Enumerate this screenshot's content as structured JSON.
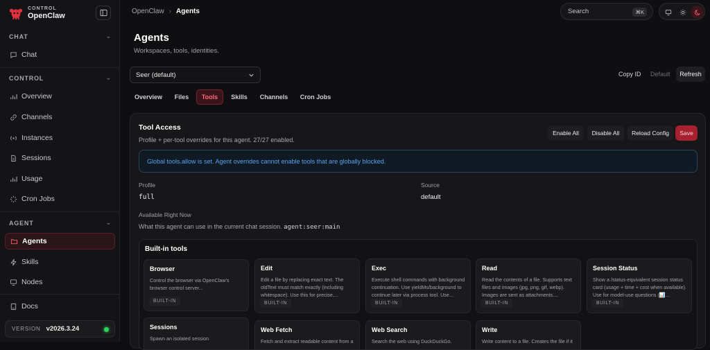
{
  "brand": {
    "small": "CONTROL",
    "name": "OpenClaw"
  },
  "sidebar": {
    "chat_section": "CHAT",
    "control_section": "CONTROL",
    "agent_section": "AGENT",
    "items": {
      "chat": "Chat",
      "overview": "Overview",
      "channels": "Channels",
      "instances": "Instances",
      "sessions": "Sessions",
      "usage": "Usage",
      "cron": "Cron Jobs",
      "agents": "Agents",
      "skills": "Skills",
      "nodes": "Nodes",
      "docs": "Docs"
    },
    "version_label": "VERSION",
    "version_value": "v2026.3.24"
  },
  "topbar": {
    "breadcrumb_root": "OpenClaw",
    "breadcrumb_sep": "›",
    "breadcrumb_current": "Agents",
    "search_placeholder": "Search",
    "search_shortcut": "⌘K"
  },
  "page": {
    "title": "Agents",
    "subtitle": "Workspaces, tools, identities."
  },
  "agent_select": {
    "value": "Seer (default)"
  },
  "header_actions": {
    "copy_id": "Copy ID",
    "default": "Default",
    "refresh": "Refresh"
  },
  "tabs": [
    "Overview",
    "Files",
    "Tools",
    "Skills",
    "Channels",
    "Cron Jobs"
  ],
  "tool_access": {
    "title": "Tool Access",
    "subtitle": "Profile + per-tool overrides for this agent. 27/27 enabled.",
    "actions": {
      "enable_all": "Enable All",
      "disable_all": "Disable All",
      "reload": "Reload Config",
      "save": "Save"
    },
    "notice": "Global tools.allow is set. Agent overrides cannot enable tools that are globally blocked.",
    "profile_label": "Profile",
    "profile_value": "full",
    "source_label": "Source",
    "source_value": "default",
    "available_label": "Available Right Now",
    "available_sub": "What this agent can use in the current chat session.",
    "available_session": "agent:seer:main",
    "builtin_title": "Built-in tools",
    "badge": "BUILT-IN",
    "tools": [
      {
        "name": "Browser",
        "desc": "Control the browser via OpenClaw's browser control server..."
      },
      {
        "name": "Edit",
        "desc": "Edit a file by replacing exact text. The oldText must match exactly (including whitespace). Use this for precise,..."
      },
      {
        "name": "Exec",
        "desc": "Execute shell commands with background continuation. Use yieldMs/background to continue later via process tool. Use..."
      },
      {
        "name": "Read",
        "desc": "Read the contents of a file. Supports text files and images (jpg, png, gif, webp). Images are sent as attachments...."
      },
      {
        "name": "Session Status",
        "desc": "Show a /status-equivalent session status card (usage + time + cost when available). Use for model-use questions (📊..."
      },
      {
        "name": "Sessions",
        "desc": "Spawn an isolated session"
      },
      {
        "name": "Web Fetch",
        "desc": "Fetch and extract readable content from a"
      },
      {
        "name": "Web Search",
        "desc": "Search the web using DuckDuckGo."
      },
      {
        "name": "Write",
        "desc": "Write content to a file. Creates the file if it"
      }
    ]
  },
  "colors": {
    "accent": "#e0313f",
    "notice_text": "#5aa2ee",
    "status_ok": "#2ed15a"
  }
}
